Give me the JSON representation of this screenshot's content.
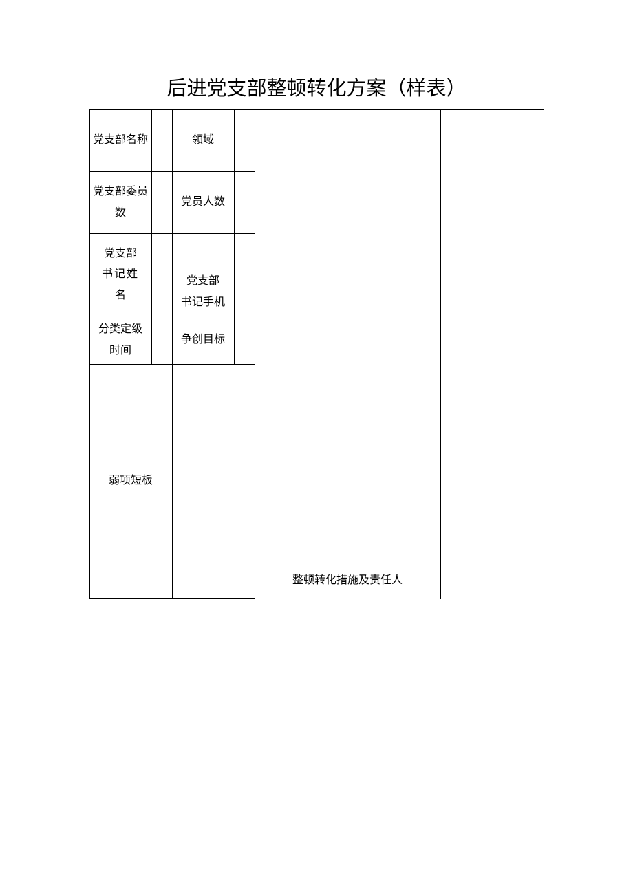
{
  "title": "后进党支部整顿转化方案（样表）",
  "labels": {
    "branch_name": "党支部名称",
    "domain": "领域",
    "committee_count": "党支部委员数",
    "member_count": "党员人数",
    "secretary_name": "党支部书记姓名",
    "secretary_phone": "党支部书记手机",
    "classification_time": "分类定级时间",
    "goal": "争创目标",
    "measures": "整顿转化措施及责任人",
    "weaknesses": "弱项短板"
  },
  "values": {
    "branch_name": "",
    "domain": "",
    "committee_count": "",
    "member_count": "",
    "secretary_name": "",
    "secretary_phone": "",
    "classification_time": "",
    "goal": "",
    "measures": "",
    "measures_extra": "",
    "weaknesses": ""
  }
}
